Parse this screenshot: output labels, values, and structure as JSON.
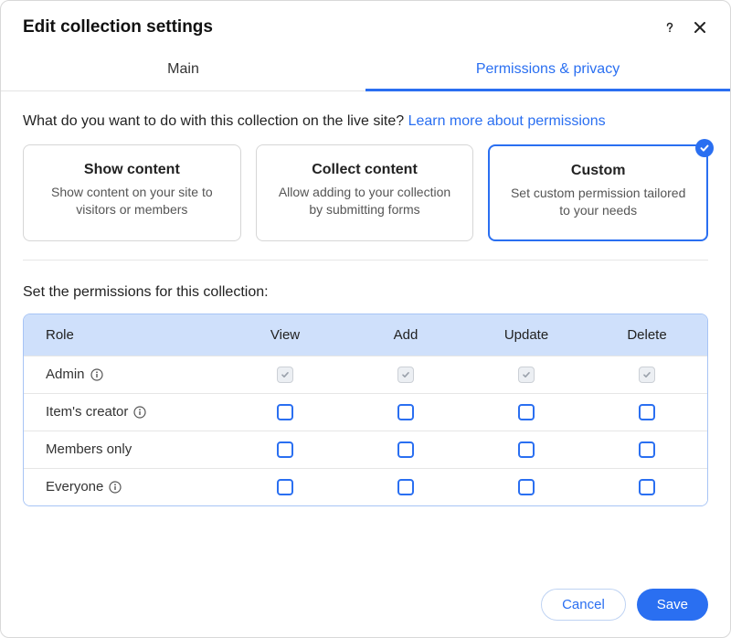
{
  "header": {
    "title": "Edit collection settings"
  },
  "tabs": {
    "main": "Main",
    "permissions": "Permissions & privacy"
  },
  "question": {
    "text": "What do you want to do with this collection on the live site? ",
    "link": "Learn more about permissions"
  },
  "cards": {
    "show": {
      "title": "Show content",
      "desc": "Show content on your site to visitors or members"
    },
    "collect": {
      "title": "Collect content",
      "desc": "Allow adding to your collection by submitting forms"
    },
    "custom": {
      "title": "Custom",
      "desc": "Set custom permission tailored to your needs"
    }
  },
  "section_label": "Set the permissions for this collection:",
  "table": {
    "headers": {
      "role": "Role",
      "view": "View",
      "add": "Add",
      "update": "Update",
      "delete": "Delete"
    },
    "rows": {
      "admin": "Admin",
      "creator": "Item's creator",
      "members": "Members only",
      "everyone": "Everyone"
    }
  },
  "footer": {
    "cancel": "Cancel",
    "save": "Save"
  }
}
